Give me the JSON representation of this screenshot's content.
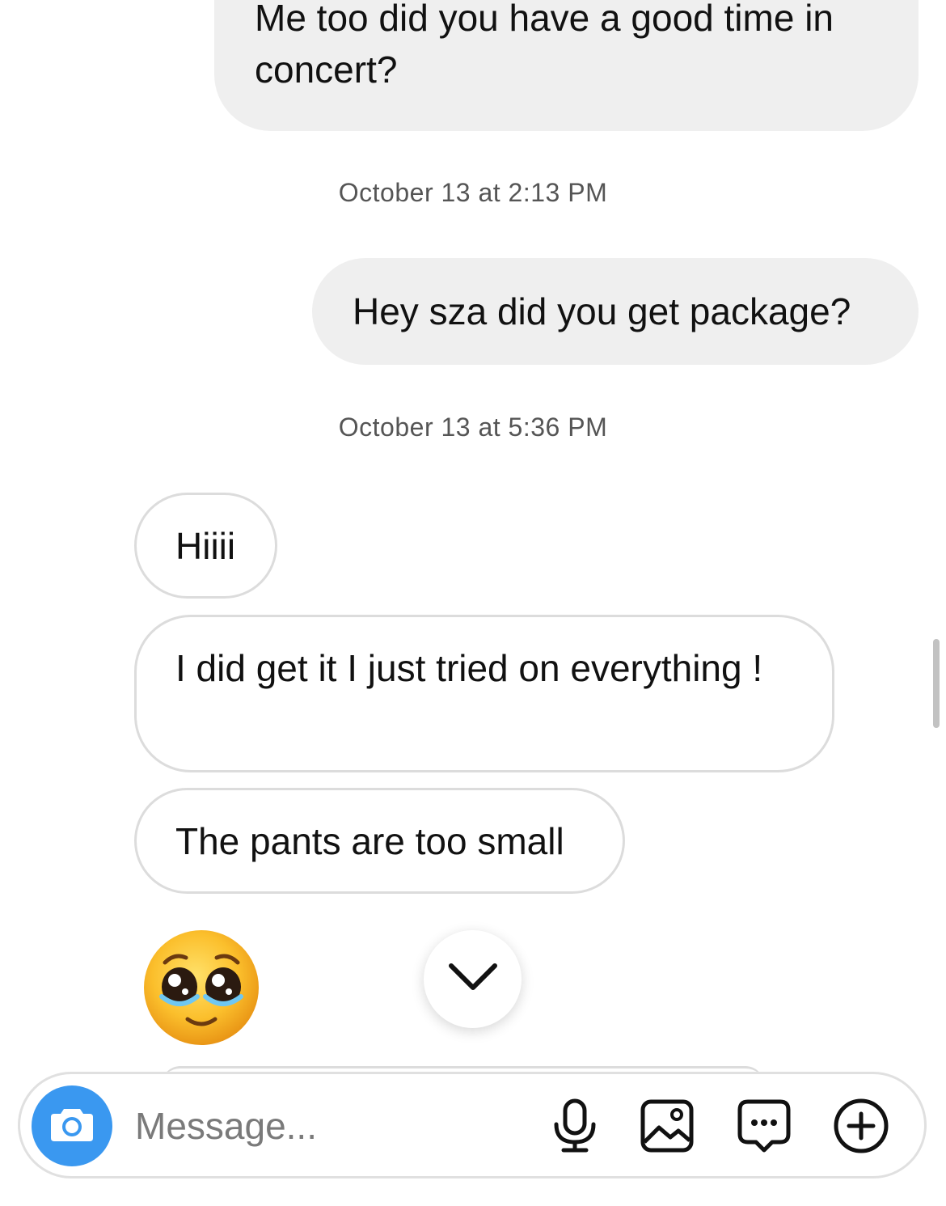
{
  "thread": {
    "messages": [
      {
        "direction": "sent",
        "text": "Me too did you have a good time in concert?"
      },
      {
        "type": "timestamp",
        "text": "October 13 at 2:13 PM"
      },
      {
        "direction": "sent",
        "text": "Hey sza did you get package?"
      },
      {
        "type": "timestamp",
        "text": "October 13 at 5:36 PM"
      },
      {
        "direction": "received",
        "text": "Hiiii"
      },
      {
        "direction": "received",
        "text": "I did get it I just tried on everything !"
      },
      {
        "direction": "received",
        "text": "The pants are too small"
      },
      {
        "direction": "received",
        "type": "emoji",
        "icon": "pleading-face-emoji"
      }
    ]
  },
  "composer": {
    "placeholder": "Message...",
    "icons": [
      "camera-icon",
      "microphone-icon",
      "gallery-icon",
      "sticker-icon",
      "plus-icon"
    ]
  },
  "colors": {
    "sent_bubble": "#efefef",
    "received_border": "#dcdcdc",
    "camera_blue": "#3a98f0",
    "timestamp_text": "#555555"
  }
}
